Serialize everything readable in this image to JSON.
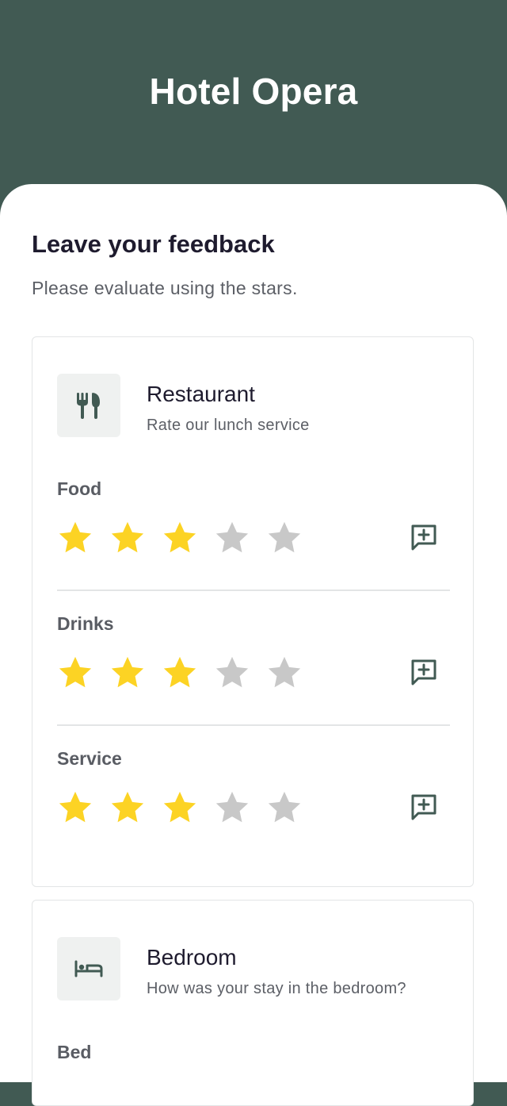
{
  "header": {
    "title": "Hotel Opera"
  },
  "page": {
    "title": "Leave your feedback",
    "subtitle": "Please evaluate using the stars."
  },
  "colors": {
    "brand": "#415a53",
    "star_filled": "#fcd324",
    "star_empty": "#c8c8c8"
  },
  "sections": [
    {
      "name": "Restaurant",
      "description": "Rate our lunch service",
      "icon": "fork-knife-icon",
      "items": [
        {
          "label": "Food",
          "rating": 3,
          "max": 5
        },
        {
          "label": "Drinks",
          "rating": 3,
          "max": 5
        },
        {
          "label": "Service",
          "rating": 3,
          "max": 5
        }
      ]
    },
    {
      "name": "Bedroom",
      "description": "How was your stay in the bedroom?",
      "icon": "bed-icon",
      "items": [
        {
          "label": "Bed"
        }
      ]
    }
  ]
}
